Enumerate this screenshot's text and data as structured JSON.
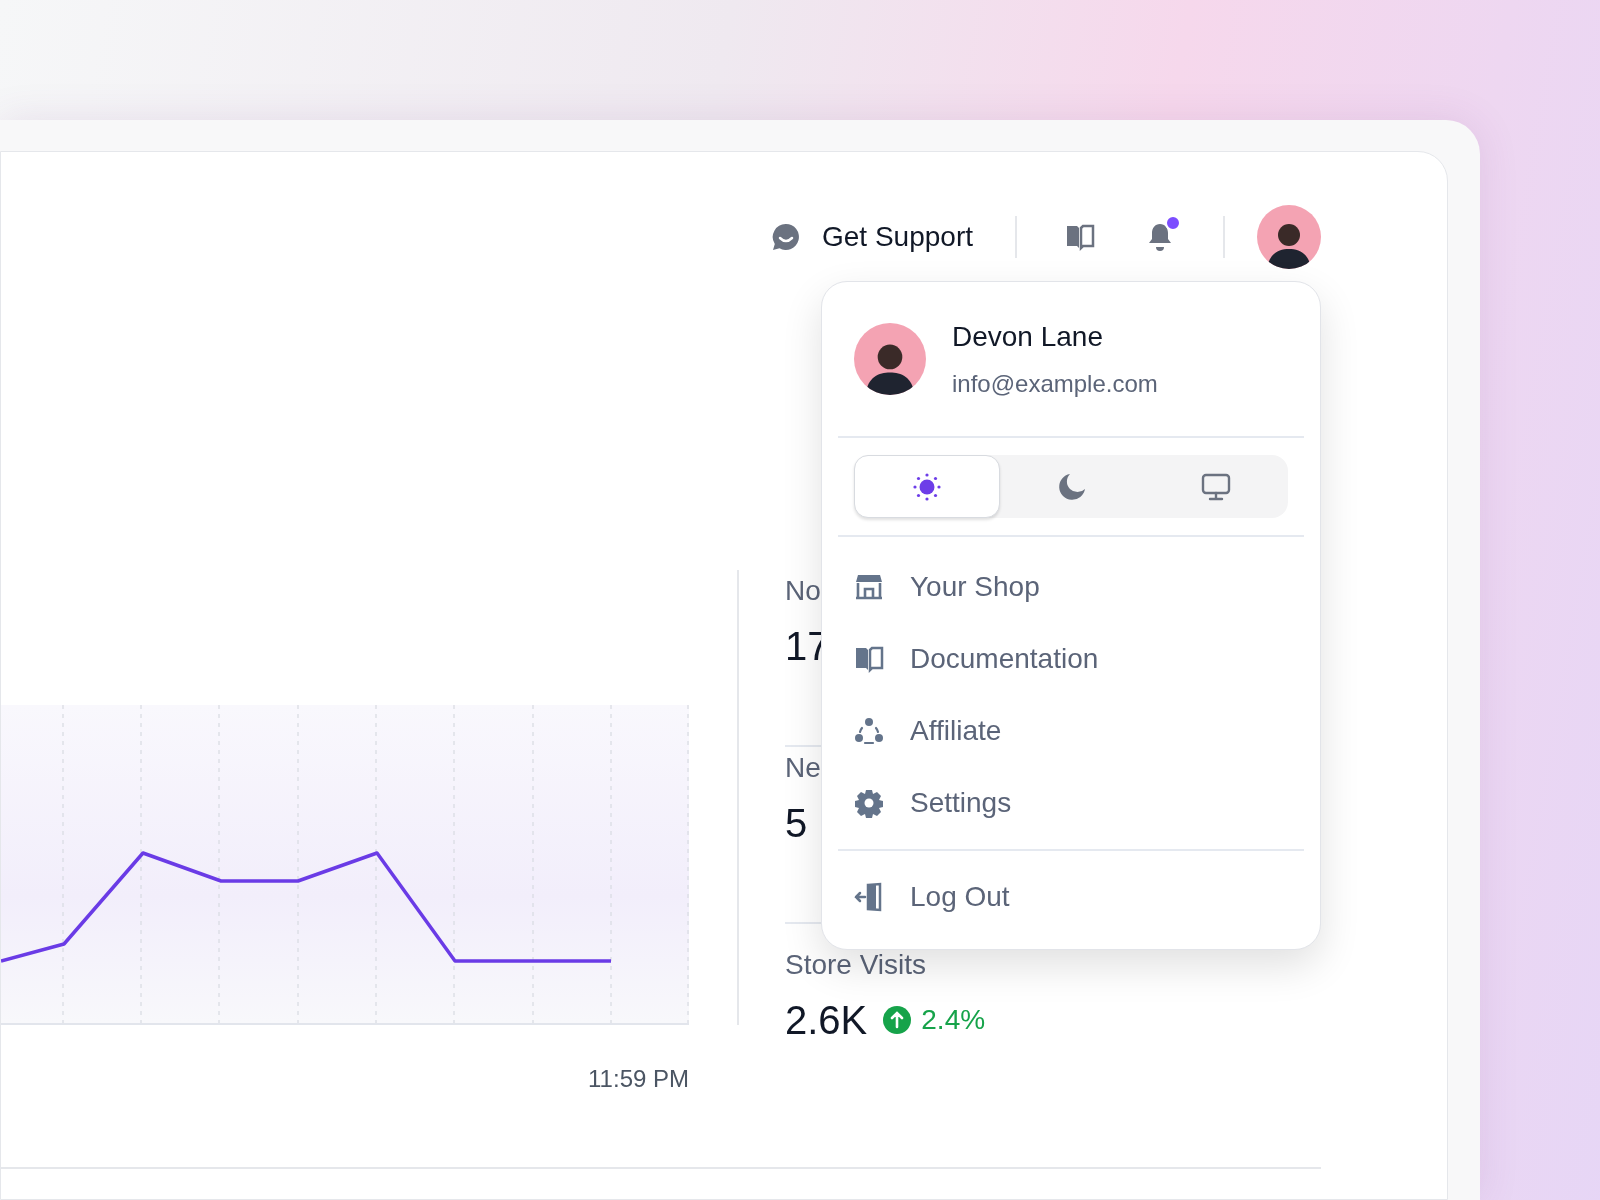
{
  "header": {
    "support_label": "Get Support",
    "notifications": {
      "unread": true
    }
  },
  "user_menu": {
    "name": "Devon Lane",
    "email": "info@example.com",
    "themes": [
      {
        "kind": "light",
        "selected": true
      },
      {
        "kind": "dark",
        "selected": false
      },
      {
        "kind": "system",
        "selected": false
      }
    ],
    "items": [
      {
        "kind": "shop",
        "label": "Your Shop"
      },
      {
        "kind": "docs",
        "label": "Documentation"
      },
      {
        "kind": "affiliate",
        "label": "Affiliate"
      },
      {
        "kind": "settings",
        "label": "Settings"
      },
      {
        "kind": "logout",
        "label": "Log Out"
      }
    ]
  },
  "chart": {
    "x_label": "11:59 PM"
  },
  "stats": [
    {
      "label": "No",
      "value": "17"
    },
    {
      "label": "Ne",
      "value": "5"
    },
    {
      "label": "Store Visits",
      "value": "2.6K",
      "change": "2.4%",
      "rising": true
    }
  ]
}
